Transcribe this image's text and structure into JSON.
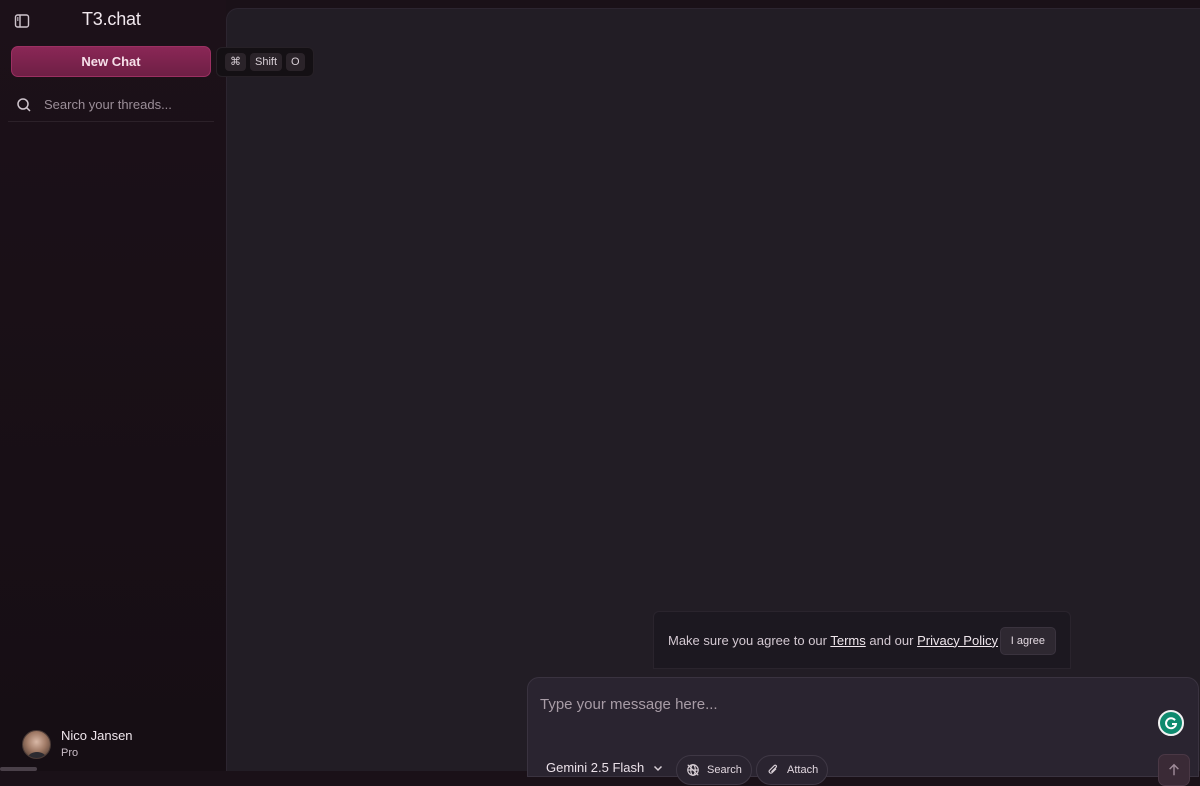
{
  "sidebar": {
    "toggle_icon": "sidebar-panel-icon",
    "brand": "T3.chat",
    "new_chat_label": "New Chat",
    "shortcut": {
      "key1": "⌘",
      "key2": "Shift",
      "key3": "O"
    },
    "search": {
      "placeholder": "Search your threads...",
      "icon": "search-icon"
    },
    "user": {
      "name": "Nico Jansen",
      "plan": "Pro"
    }
  },
  "terms": {
    "prefix": "Make sure you agree to our ",
    "terms_link": "Terms",
    "middle": " and our ",
    "privacy_link": "Privacy Policy",
    "agree_label": "I agree"
  },
  "composer": {
    "placeholder": "Type your message here...",
    "model": "Gemini 2.5 Flash",
    "search_label": "Search",
    "attach_label": "Attach"
  },
  "colors": {
    "accent": "#8a2756",
    "background": "#1a1118",
    "main_panel": "#221d25",
    "grammarly": "#0e8a6e"
  }
}
